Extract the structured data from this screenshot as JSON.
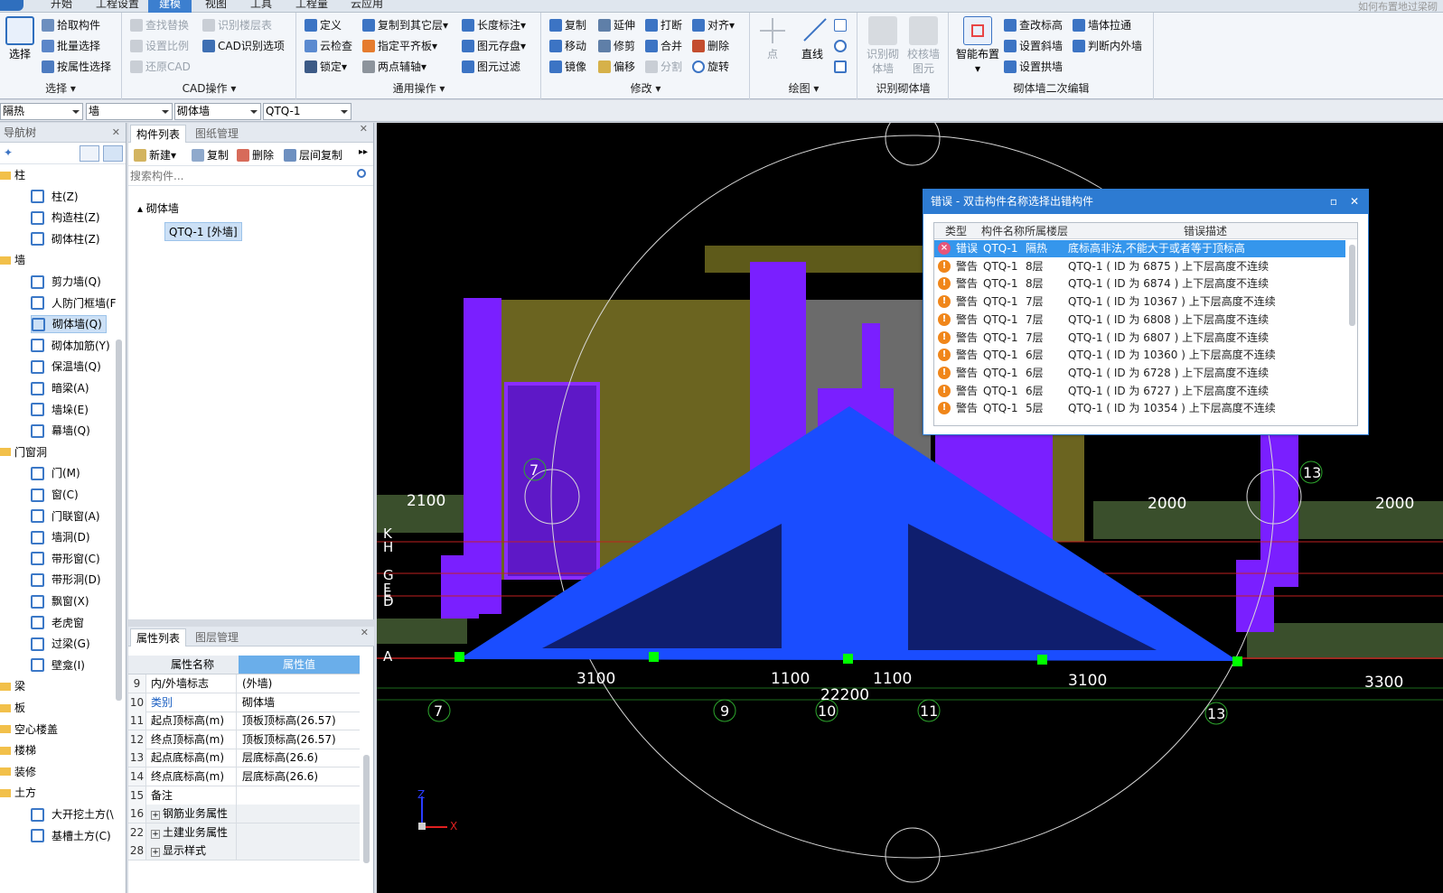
{
  "ribbon_tabs": [
    "开始",
    "工程设置",
    "建模",
    "视图",
    "工具",
    "工程量",
    "云应用"
  ],
  "active_tab": "建模",
  "ribbon_hint": "如何布置地过梁砌",
  "groups": {
    "select": {
      "caption": "选择",
      "big": "选择",
      "items": [
        "拾取构件",
        "批量选择",
        "按属性选择"
      ]
    },
    "cad": {
      "caption": "CAD操作",
      "items": [
        "查找替换",
        "识别楼层表",
        "设置比例",
        "CAD识别选项",
        "还原CAD"
      ]
    },
    "common": {
      "caption": "通用操作",
      "items": [
        "定义",
        "复制到其它层",
        "长度标注",
        "云检查",
        "指定平齐板",
        "图元存盘",
        "锁定",
        "两点辅轴",
        "图元过滤"
      ]
    },
    "modify": {
      "caption": "修改",
      "items": [
        "复制",
        "延伸",
        "打断",
        "对齐",
        "移动",
        "修剪",
        "合并",
        "删除",
        "镜像",
        "偏移",
        "分割",
        "旋转"
      ]
    },
    "draw": {
      "caption": "绘图",
      "items": [
        "点",
        "直线"
      ]
    },
    "recognize": {
      "caption": "识别砌体墙",
      "items": [
        "识别砌体墙",
        "校核墙图元"
      ]
    },
    "masonry2": {
      "caption": "砌体墙二次编辑",
      "items": [
        "智能布置",
        "查改标高",
        "墙体拉通",
        "设置斜墙",
        "判断内外墙",
        "设置拱墙"
      ]
    }
  },
  "combos": [
    "隔热",
    "墙",
    "砌体墙",
    "QTQ-1"
  ],
  "nav": {
    "title": "导航树",
    "cats": [
      {
        "label": "柱",
        "items": [
          "柱(Z)",
          "构造柱(Z)",
          "砌体柱(Z)"
        ]
      },
      {
        "label": "墙",
        "items": [
          "剪力墙(Q)",
          "人防门框墙(F",
          "砌体墙(Q)",
          "砌体加筋(Y)",
          "保温墙(Q)",
          "暗梁(A)",
          "墙垛(E)",
          "幕墙(Q)"
        ]
      },
      {
        "label": "门窗洞",
        "items": [
          "门(M)",
          "窗(C)",
          "门联窗(A)",
          "墙洞(D)",
          "带形窗(C)",
          "带形洞(D)",
          "飘窗(X)",
          "老虎窗",
          "过梁(G)",
          "壁龛(I)"
        ]
      },
      {
        "label": "梁",
        "items": []
      },
      {
        "label": "板",
        "items": []
      },
      {
        "label": "空心楼盖",
        "items": []
      },
      {
        "label": "楼梯",
        "items": []
      },
      {
        "label": "装修",
        "items": []
      },
      {
        "label": "土方",
        "items": [
          "大开挖土方(\\",
          "基槽土方(C)"
        ]
      }
    ],
    "selected": "砌体墙(Q)"
  },
  "component_panel": {
    "tabs": [
      "构件列表",
      "图纸管理"
    ],
    "toolbar": [
      "新建",
      "复制",
      "删除",
      "层间复制"
    ],
    "search_placeholder": "搜索构件...",
    "tree_root": "砌体墙",
    "selected_component": "QTQ-1 [外墙]"
  },
  "property_panel": {
    "tabs": [
      "属性列表",
      "图层管理"
    ],
    "headers": [
      "属性名称",
      "属性值"
    ],
    "rows": [
      {
        "n": "9",
        "k": "内/外墙标志",
        "v": "(外墙)"
      },
      {
        "n": "10",
        "k": "类别",
        "v": "砌体墙"
      },
      {
        "n": "11",
        "k": "起点顶标高(m)",
        "v": "顶板顶标高(26.57)"
      },
      {
        "n": "12",
        "k": "终点顶标高(m)",
        "v": "顶板顶标高(26.57)"
      },
      {
        "n": "13",
        "k": "起点底标高(m)",
        "v": "层底标高(26.6)"
      },
      {
        "n": "14",
        "k": "终点底标高(m)",
        "v": "层底标高(26.6)"
      },
      {
        "n": "15",
        "k": "备注",
        "v": ""
      },
      {
        "n": "16",
        "k": "钢筋业务属性",
        "v": ""
      },
      {
        "n": "22",
        "k": "土建业务属性",
        "v": ""
      },
      {
        "n": "28",
        "k": "显示样式",
        "v": ""
      }
    ]
  },
  "error_dialog": {
    "title": "错误 - 双击构件名称选择出错构件",
    "headers": [
      "类型",
      "构件名称",
      "所属楼层",
      "错误描述"
    ],
    "rows": [
      {
        "type": "错误",
        "name": "QTQ-1",
        "floor": "隔热",
        "desc": "底标高非法,不能大于或者等于顶标高"
      },
      {
        "type": "警告",
        "name": "QTQ-1",
        "floor": "8层",
        "desc": "QTQ-1 ( ID 为 6875 ) 上下层高度不连续"
      },
      {
        "type": "警告",
        "name": "QTQ-1",
        "floor": "8层",
        "desc": "QTQ-1 ( ID 为 6874 ) 上下层高度不连续"
      },
      {
        "type": "警告",
        "name": "QTQ-1",
        "floor": "7层",
        "desc": "QTQ-1 ( ID 为 10367 ) 上下层高度不连续"
      },
      {
        "type": "警告",
        "name": "QTQ-1",
        "floor": "7层",
        "desc": "QTQ-1 ( ID 为 6808 ) 上下层高度不连续"
      },
      {
        "type": "警告",
        "name": "QTQ-1",
        "floor": "7层",
        "desc": "QTQ-1 ( ID 为 6807 ) 上下层高度不连续"
      },
      {
        "type": "警告",
        "name": "QTQ-1",
        "floor": "6层",
        "desc": "QTQ-1 ( ID 为 10360 ) 上下层高度不连续"
      },
      {
        "type": "警告",
        "name": "QTQ-1",
        "floor": "6层",
        "desc": "QTQ-1 ( ID 为 6728 ) 上下层高度不连续"
      },
      {
        "type": "警告",
        "name": "QTQ-1",
        "floor": "6层",
        "desc": "QTQ-1 ( ID 为 6727 ) 上下层高度不连续"
      },
      {
        "type": "警告",
        "name": "QTQ-1",
        "floor": "5层",
        "desc": "QTQ-1 ( ID 为 10354 ) 上下层高度不连续"
      }
    ]
  },
  "viewport": {
    "dims": [
      "3100",
      "1100",
      "1100",
      "22200",
      "3100",
      "3300",
      "2100",
      "2000",
      "2000"
    ],
    "axes_bottom": [
      "7",
      "9",
      "10",
      "11",
      "13"
    ],
    "axes_left": [
      "K",
      "H",
      "G",
      "F",
      "E",
      "D",
      "A"
    ],
    "axes_upper": [
      "7",
      "13"
    ],
    "coord_labels": [
      "Z",
      "X"
    ]
  },
  "colors": {
    "accent": "#2d7bd2",
    "wall_blue": "#1a4dff",
    "purple": "#7a1fff",
    "olive": "#5e5a1a",
    "grid_green": "#00ff00"
  }
}
